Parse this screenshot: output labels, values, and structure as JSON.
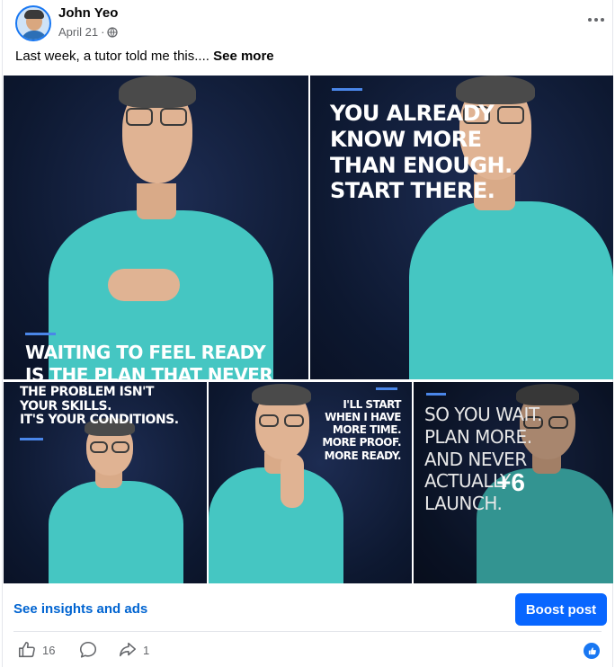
{
  "post": {
    "author": "John Yeo",
    "date": "April 21",
    "visibility_sep": "·",
    "caption": "Last week, a tutor told me this....",
    "see_more": "See more"
  },
  "photos": [
    {
      "text_lines": [
        "WAITING TO FEEL READY",
        "IS THE PLAN THAT NEVER WORKS"
      ]
    },
    {
      "text_lines": [
        "YOU ALREADY",
        "KNOW MORE",
        "THAN ENOUGH.",
        "START THERE."
      ]
    },
    {
      "text_lines": [
        "THE PROBLEM ISN'T",
        "YOUR SKILLS.",
        "IT'S YOUR CONDITIONS."
      ]
    },
    {
      "text_lines": [
        "I'LL START",
        "WHEN I HAVE",
        "MORE TIME.",
        "MORE PROOF.",
        "MORE READY."
      ]
    },
    {
      "text_lines": [
        "SO YOU WAIT.",
        "PLAN MORE.",
        "AND NEVER",
        "ACTUALLY",
        "LAUNCH."
      ],
      "overflow_count": "+6"
    }
  ],
  "footer": {
    "insights": "See insights and ads",
    "boost": "Boost post"
  },
  "actions": {
    "likes": "16",
    "shares": "1"
  },
  "icons": {
    "like": "thumbs-up-icon",
    "comment": "comment-bubble-icon",
    "share": "share-arrow-icon",
    "more": "more-dots-icon",
    "globe": "globe-icon",
    "reaction": "like-reaction-icon"
  },
  "colors": {
    "accent_blue": "#0866ff",
    "link_blue": "#0064d1",
    "shirt": "#45c6c2",
    "photo_bg": "#0d1830"
  }
}
